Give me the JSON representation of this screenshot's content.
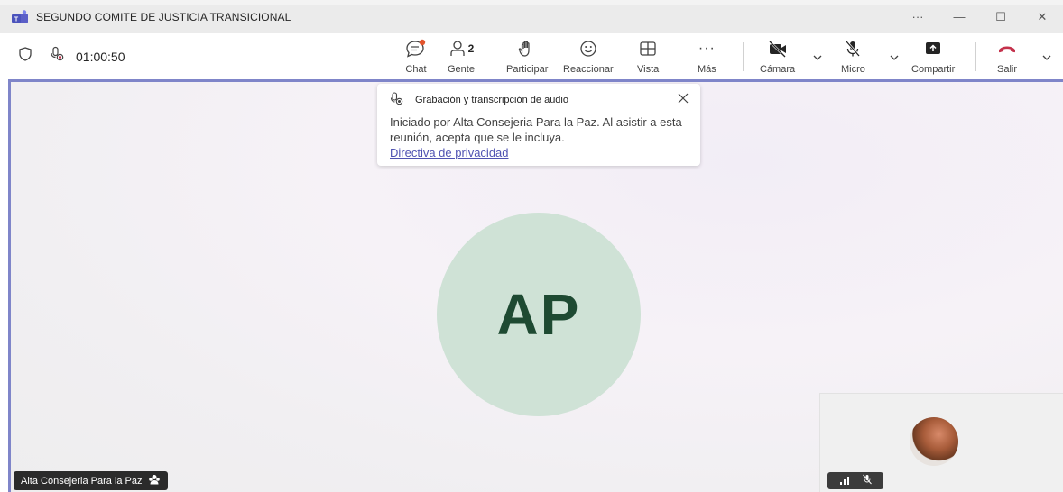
{
  "window": {
    "title": "SEGUNDO COMITE DE JUSTICIA TRANSICIONAL",
    "more_label": "···",
    "minimize_label": "—",
    "maximize_label": "☐",
    "close_label": "✕"
  },
  "toolbar": {
    "timer": "01:00:50",
    "people_count": "2",
    "chat_label": "Chat",
    "people_label": "Gente",
    "raise_hand_label": "Participar",
    "react_label": "Reaccionar",
    "view_label": "Vista",
    "more_label": "Más",
    "more_icon": "···",
    "camera_label": "Cámara",
    "mic_label": "Micro",
    "share_label": "Compartir",
    "leave_label": "Salir"
  },
  "notice": {
    "title": "Grabación y transcripción de audio",
    "body": "Iniciado por Alta Consejeria Para la Paz. Al asistir a esta reunión, acepta que se le incluya.",
    "link": "Directiva de privacidad"
  },
  "stage": {
    "avatar_initials": "AP",
    "participant_name": "Alta Consejeria Para la Paz"
  },
  "colors": {
    "accent": "#7f85c9",
    "avatar_bg": "#cfe2d6",
    "avatar_text": "#1e4a32",
    "leave_red": "#c4314b",
    "link": "#4f52b2"
  }
}
